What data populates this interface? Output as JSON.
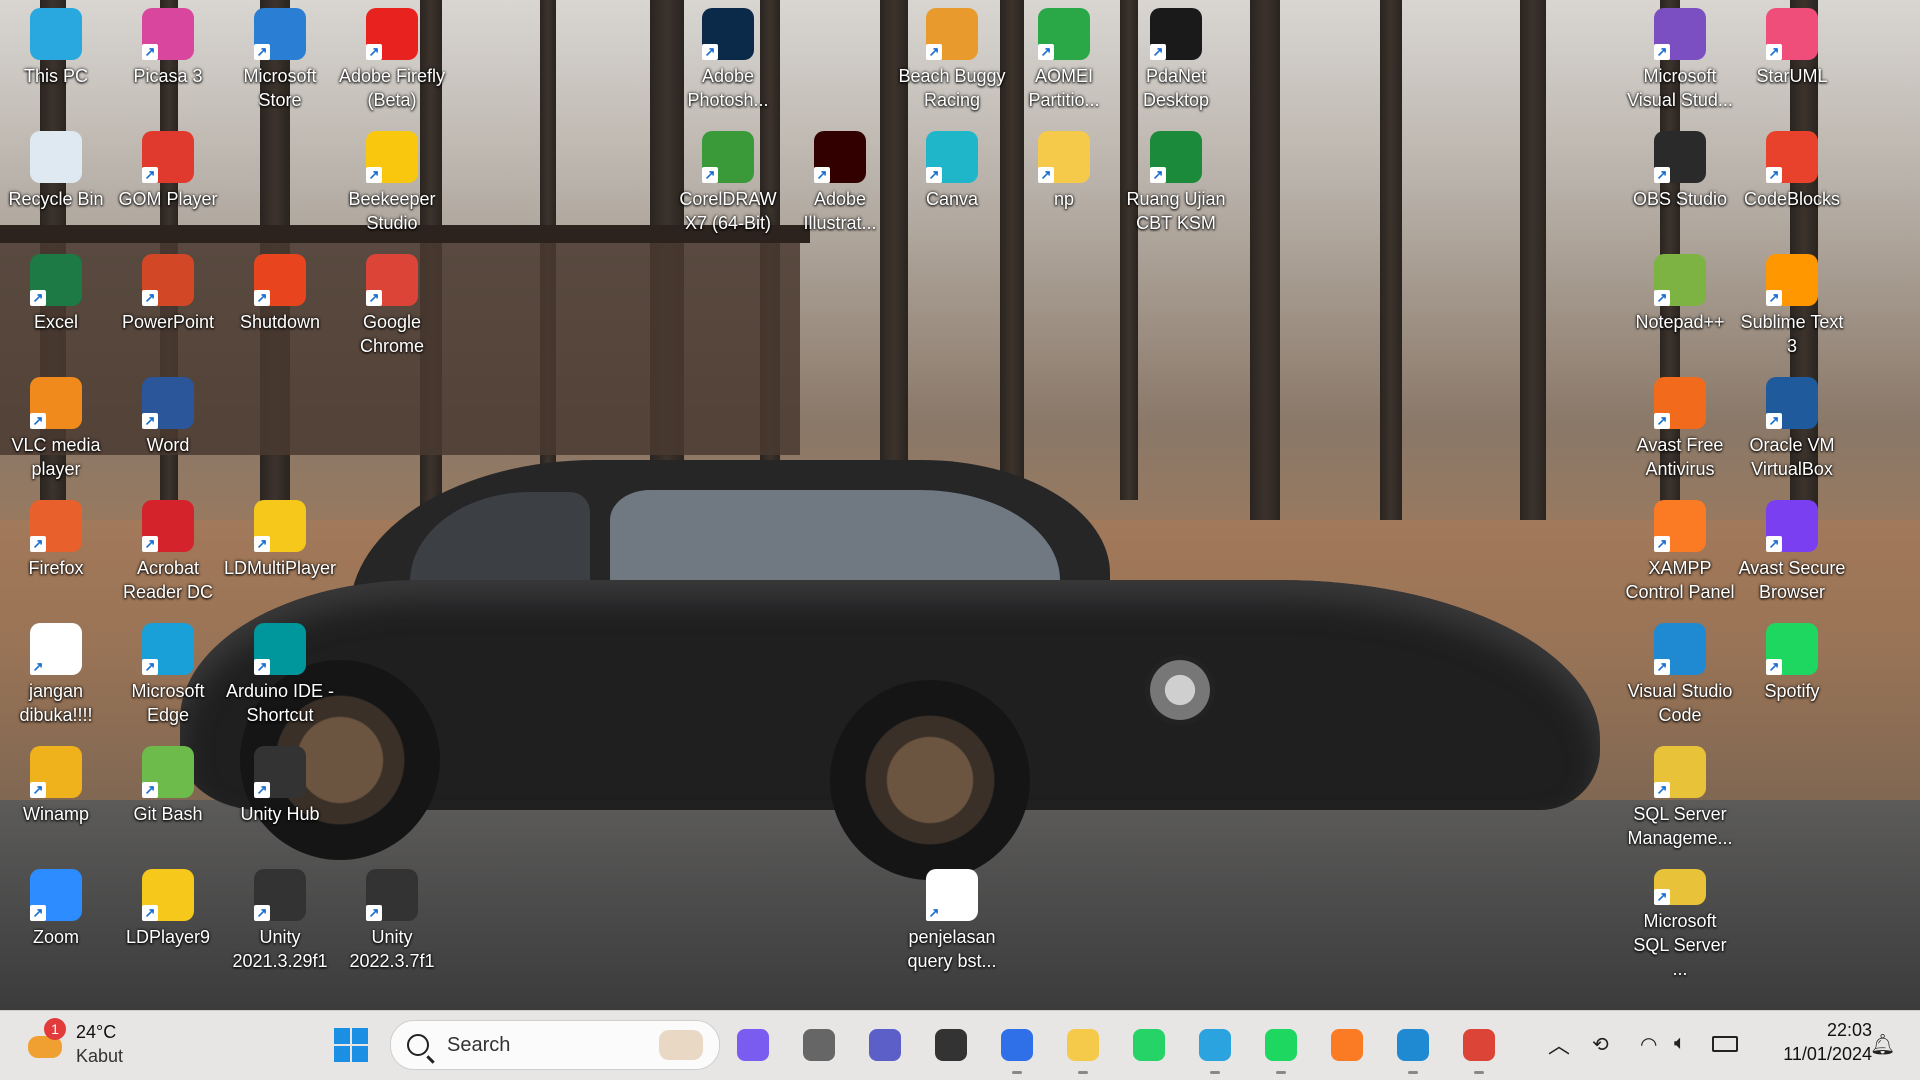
{
  "desktop": {
    "icons": [
      {
        "label": "This PC",
        "icon": "monitor-icon",
        "color": "#29a8e0"
      },
      {
        "label": "Recycle Bin",
        "icon": "recycle-bin-icon",
        "color": "#dfe9f2"
      },
      {
        "label": "Excel",
        "icon": "excel-icon",
        "color": "#1d7a45"
      },
      {
        "label": "VLC media\nplayer",
        "icon": "vlc-icon",
        "color": "#f08a1c"
      },
      {
        "label": "Firefox",
        "icon": "firefox-icon",
        "color": "#e8612c"
      },
      {
        "label": "jangan\ndibuka!!!!",
        "icon": "script-file-icon",
        "color": "#ffffff"
      },
      {
        "label": "Winamp",
        "icon": "winamp-icon",
        "color": "#f0b21c"
      },
      {
        "label": "Zoom",
        "icon": "zoom-icon",
        "color": "#2d8cff"
      },
      {
        "label": "Picasa 3",
        "icon": "picasa-icon",
        "color": "#d8469e"
      },
      {
        "label": "GOM Player",
        "icon": "gom-player-icon",
        "color": "#e03a2e"
      },
      {
        "label": "PowerPoint",
        "icon": "powerpoint-icon",
        "color": "#d24726"
      },
      {
        "label": "Word",
        "icon": "word-icon",
        "color": "#2b579a"
      },
      {
        "label": "Acrobat\nReader DC",
        "icon": "acrobat-icon",
        "color": "#d4232b"
      },
      {
        "label": "Microsoft\nEdge",
        "icon": "edge-icon",
        "color": "#1aa0d8"
      },
      {
        "label": "Git Bash",
        "icon": "git-bash-icon",
        "color": "#6dbb4a"
      },
      {
        "label": "LDPlayer9",
        "icon": "ldplayer-icon",
        "color": "#f5c81b"
      },
      {
        "label": "Microsoft\nStore",
        "icon": "store-icon",
        "color": "#2a7fd4"
      },
      {
        "label": "Shutdown",
        "icon": "shutdown-icon",
        "color": "#e8451f"
      },
      {
        "label": "LDMultiPlayer",
        "icon": "ldmultiplayer-icon",
        "color": "#f5c81b"
      },
      {
        "label": "Arduino IDE -\nShortcut",
        "icon": "arduino-icon",
        "color": "#00979c"
      },
      {
        "label": "Unity Hub",
        "icon": "unity-hub-icon",
        "color": "#333333"
      },
      {
        "label": "Unity\n2021.3.29f1",
        "icon": "unity-icon",
        "color": "#333333"
      },
      {
        "label": "Adobe Firefly\n(Beta)",
        "icon": "firefly-icon",
        "color": "#e8231f"
      },
      {
        "label": "Beekeeper\nStudio",
        "icon": "beekeeper-icon",
        "color": "#f9c80e"
      },
      {
        "label": "Google\nChrome",
        "icon": "chrome-icon",
        "color": "#db4437"
      },
      {
        "label": "Unity\n2022.3.7f1",
        "icon": "unity-icon",
        "color": "#333333"
      },
      {
        "label": "Adobe\nPhotosh...",
        "icon": "photoshop-icon",
        "color": "#0b2a4a"
      },
      {
        "label": "CorelDRAW\nX7 (64-Bit)",
        "icon": "coreldraw-icon",
        "color": "#3a9a3a"
      },
      {
        "label": "Adobe\nIllustrat...",
        "icon": "illustrator-icon",
        "color": "#330000"
      },
      {
        "label": "Beach Buggy\nRacing",
        "icon": "beach-buggy-icon",
        "color": "#e89a2c"
      },
      {
        "label": "Canva",
        "icon": "canva-icon",
        "color": "#1fb6c9"
      },
      {
        "label": "penjelasan\nquery bst...",
        "icon": "text-file-icon",
        "color": "#ffffff"
      },
      {
        "label": "AOMEI\nPartitio...",
        "icon": "aomei-icon",
        "color": "#2aa848"
      },
      {
        "label": "np",
        "icon": "folder-icon",
        "color": "#f5c94a"
      },
      {
        "label": "PdaNet\nDesktop",
        "icon": "pdanet-icon",
        "color": "#1a1a1a"
      },
      {
        "label": "Ruang Ujian\nCBT KSM",
        "icon": "cbt-icon",
        "color": "#1b8a3a"
      },
      {
        "label": "Microsoft\nVisual Stud...",
        "icon": "visual-studio-icon",
        "color": "#7b4fc1"
      },
      {
        "label": "OBS Studio",
        "icon": "obs-icon",
        "color": "#2a2a2a"
      },
      {
        "label": "Notepad++",
        "icon": "notepadpp-icon",
        "color": "#7cb342"
      },
      {
        "label": "Avast Free\nAntivirus",
        "icon": "avast-icon",
        "color": "#f26b1d"
      },
      {
        "label": "XAMPP\nControl Panel",
        "icon": "xampp-icon",
        "color": "#fb7a24"
      },
      {
        "label": "Visual Studio\nCode",
        "icon": "vscode-icon",
        "color": "#1f8ad2"
      },
      {
        "label": "SQL Server\nManageme...",
        "icon": "ssms-icon",
        "color": "#e8c33a"
      },
      {
        "label": "Microsoft\nSQL Server ...",
        "icon": "sql-server-icon",
        "color": "#e8c33a"
      },
      {
        "label": "StarUML",
        "icon": "staruml-icon",
        "color": "#f04e7a"
      },
      {
        "label": "CodeBlocks",
        "icon": "codeblocks-icon",
        "color": "#e8412c"
      },
      {
        "label": "Sublime Text\n3",
        "icon": "sublime-icon",
        "color": "#ff9800"
      },
      {
        "label": "Oracle VM\nVirtualBox",
        "icon": "virtualbox-icon",
        "color": "#1e5a9c"
      },
      {
        "label": "Avast Secure\nBrowser",
        "icon": "avast-browser-icon",
        "color": "#7b3ff2"
      },
      {
        "label": "Spotify",
        "icon": "spotify-icon",
        "color": "#1ed760"
      }
    ]
  },
  "taskbar": {
    "weather": {
      "temp": "24°C",
      "condition": "Kabut",
      "badge": "1"
    },
    "search_placeholder": "Search",
    "apps": [
      {
        "name": "copilot-pre-icon",
        "color": "#7a5cf0"
      },
      {
        "name": "task-view-icon",
        "color": "#666666"
      },
      {
        "name": "teams-chat-icon",
        "color": "#5b5fc7"
      },
      {
        "name": "unity-icon",
        "color": "#333333"
      },
      {
        "name": "copilot-icon",
        "color": "#2f6fe8"
      },
      {
        "name": "file-explorer-icon",
        "color": "#f5c94a"
      },
      {
        "name": "whatsapp-icon",
        "color": "#25d366"
      },
      {
        "name": "telegram-icon",
        "color": "#2aa3df"
      },
      {
        "name": "spotify-icon",
        "color": "#1ed760"
      },
      {
        "name": "xampp-icon",
        "color": "#fb7a24"
      },
      {
        "name": "vscode-icon",
        "color": "#1f8ad2"
      },
      {
        "name": "chrome-icon",
        "color": "#db4437"
      }
    ],
    "time": "22:03",
    "date": "11/01/2024"
  }
}
